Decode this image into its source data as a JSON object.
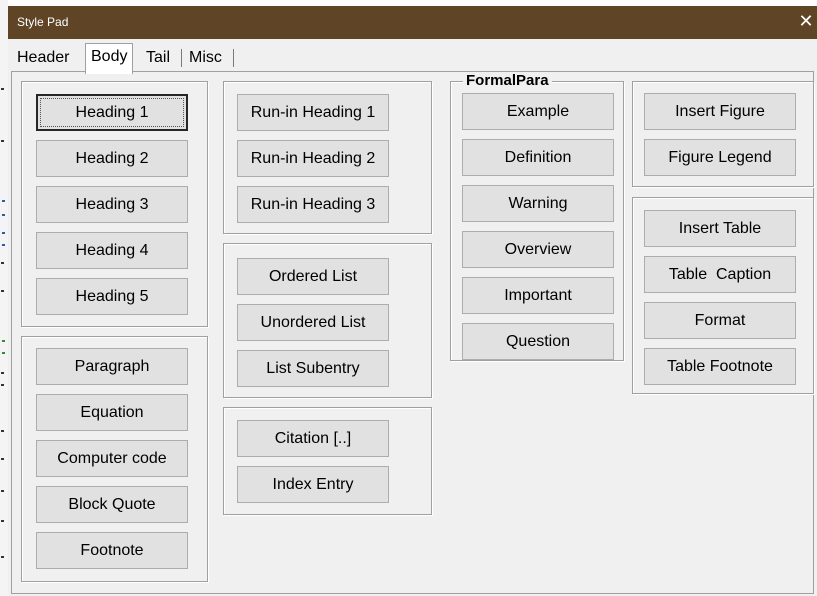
{
  "window": {
    "title": "Style Pad",
    "close_icon": "close-icon"
  },
  "tabs": [
    {
      "label": "Header"
    },
    {
      "label": "Body",
      "active": true
    },
    {
      "label": "Tail"
    },
    {
      "label": "Misc"
    }
  ],
  "body": {
    "headings": [
      "Heading 1",
      "Heading 2",
      "Heading 3",
      "Heading 4",
      "Heading 5"
    ],
    "paragraph_styles": [
      "Paragraph",
      "Equation",
      "Computer code",
      "Block Quote",
      "Footnote"
    ],
    "runin_headings": [
      "Run-in Heading 1",
      "Run-in Heading 2",
      "Run-in Heading 3"
    ],
    "lists": [
      "Ordered List",
      "Unordered List",
      "List Subentry"
    ],
    "references": [
      "Citation [..]",
      "Index Entry"
    ],
    "formal_para": {
      "label": "FormalPara",
      "items": [
        "Example",
        "Definition",
        "Warning",
        "Overview",
        "Important",
        "Question"
      ]
    },
    "figures": [
      "Insert Figure",
      "Figure Legend"
    ],
    "tables": [
      "Insert Table",
      "Table  Caption",
      "Format",
      "Table Footnote"
    ]
  },
  "colors": {
    "titlebar": "#5f4526",
    "client_bg": "#f0f0f0",
    "button_face": "#e1e1e1",
    "button_border": "#adadad"
  }
}
